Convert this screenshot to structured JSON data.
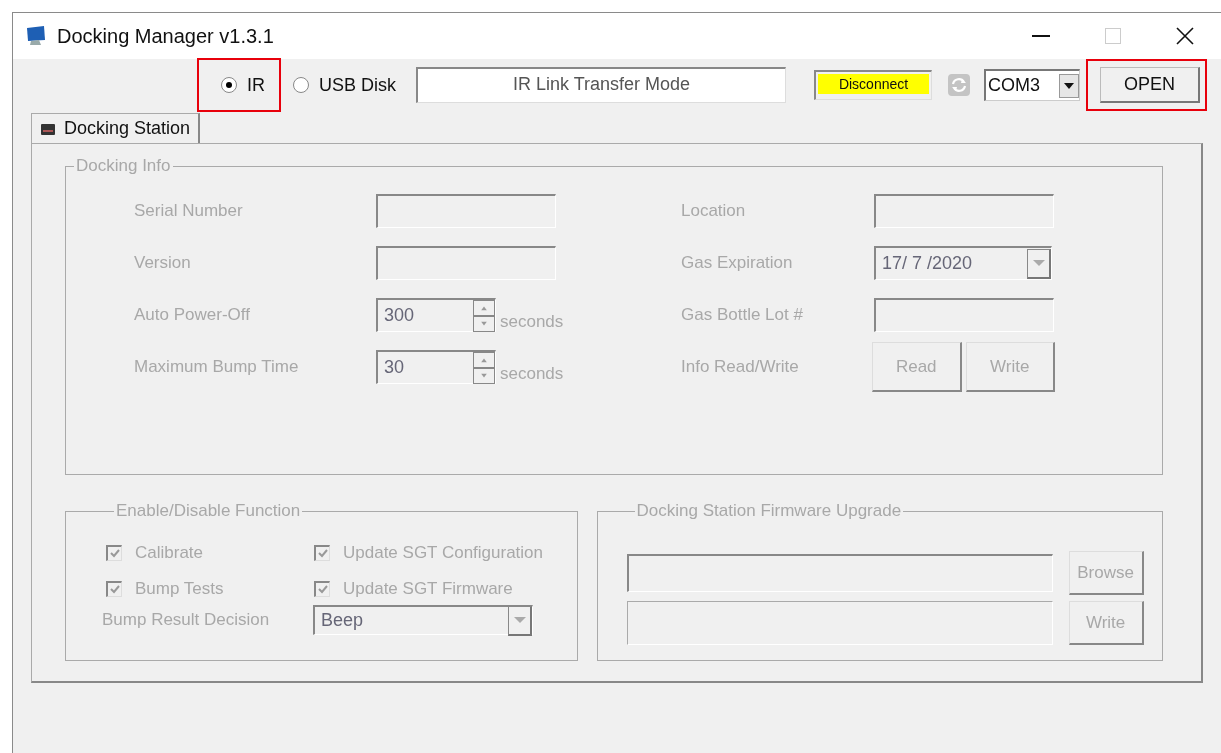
{
  "window": {
    "title": "Docking Manager v1.3.1"
  },
  "transfer_modes": [
    {
      "label": "IR",
      "selected": true,
      "highlighted": true
    },
    {
      "label": "USB Disk",
      "selected": false,
      "highlighted": false
    }
  ],
  "mode_display": "IR Link Transfer Mode",
  "connection_status": "Disconnect",
  "port": {
    "value": "COM3"
  },
  "open_button": {
    "label": "OPEN",
    "highlighted": true
  },
  "tabs": [
    {
      "label": "Docking Station",
      "selected": true
    }
  ],
  "docking_info": {
    "title": "Docking Info",
    "disabled": true,
    "left_fields": [
      {
        "kind": "text",
        "label": "Serial Number"
      },
      {
        "kind": "text",
        "label": "Version"
      },
      {
        "kind": "spinner",
        "label": "Auto Power-Off",
        "value": "300",
        "unit": "seconds"
      },
      {
        "kind": "spinner",
        "label": "Maximum Bump Time",
        "value": "30",
        "unit": "seconds"
      }
    ],
    "right_fields": [
      {
        "kind": "text",
        "label": "Location"
      },
      {
        "kind": "date",
        "label": "Gas Expiration",
        "value": "17/ 7 /2020"
      },
      {
        "kind": "text",
        "label": "Gas Bottle Lot #"
      },
      {
        "kind": "buttons",
        "label": "Info Read/Write",
        "buttons": [
          "Read",
          "Write"
        ]
      }
    ]
  },
  "functions": {
    "title": "Enable/Disable Function",
    "disabled": true,
    "checkboxes": [
      {
        "label": "Calibrate",
        "checked": true
      },
      {
        "label": "Update SGT Configuration",
        "checked": true
      },
      {
        "label": "Bump Tests",
        "checked": true
      },
      {
        "label": "Update SGT Firmware",
        "checked": true
      }
    ],
    "decision": {
      "label": "Bump Result Decision",
      "value": "Beep"
    }
  },
  "firmware": {
    "title": "Docking Station Firmware Upgrade",
    "disabled": true,
    "buttons": [
      "Browse",
      "Write"
    ]
  }
}
